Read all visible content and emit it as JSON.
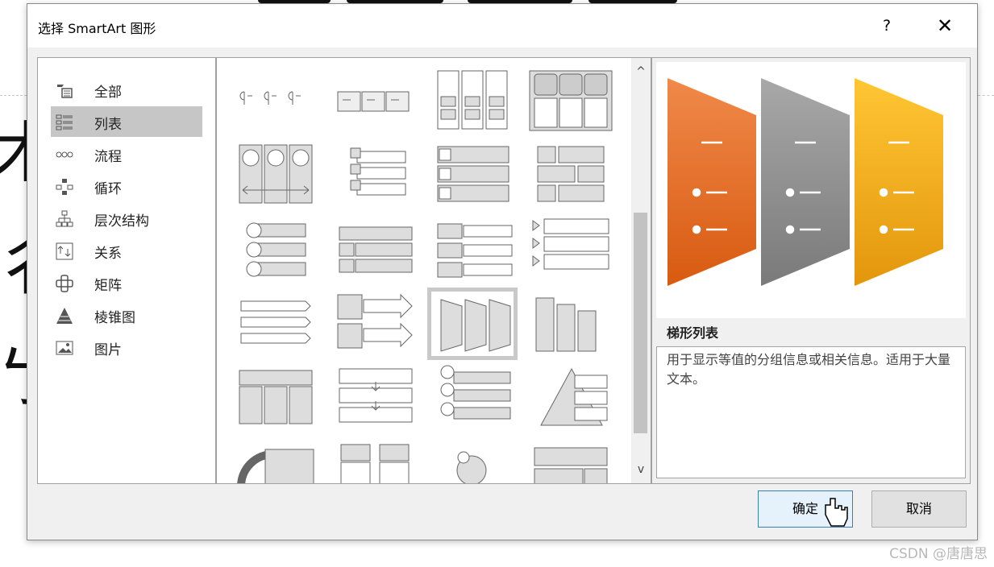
{
  "dialog": {
    "title": "选择 SmartArt 图形",
    "help_label": "?",
    "close_label": "✕"
  },
  "categories": [
    {
      "label": "全部",
      "icon": "all-icon"
    },
    {
      "label": "列表",
      "icon": "list-icon",
      "selected": true
    },
    {
      "label": "流程",
      "icon": "process-icon"
    },
    {
      "label": "循环",
      "icon": "cycle-icon"
    },
    {
      "label": "层次结构",
      "icon": "hierarchy-icon"
    },
    {
      "label": "关系",
      "icon": "relationship-icon"
    },
    {
      "label": "矩阵",
      "icon": "matrix-icon"
    },
    {
      "label": "棱锥图",
      "icon": "pyramid-icon"
    },
    {
      "label": "图片",
      "icon": "picture-icon"
    }
  ],
  "gallery": {
    "selected_index": 10,
    "scroll_up": "^",
    "scroll_down": "v"
  },
  "preview": {
    "name": "梯形列表",
    "description": "用于显示等值的分组信息或相关信息。适用于大量文本。",
    "colors": [
      "#e8712a",
      "#8c8c8c",
      "#f0a820"
    ]
  },
  "buttons": {
    "ok": "确定",
    "cancel": "取消"
  },
  "background": {
    "chars": [
      "木",
      "彳",
      "ㄅ"
    ],
    "watermark": "CSDN @唐唐思"
  }
}
